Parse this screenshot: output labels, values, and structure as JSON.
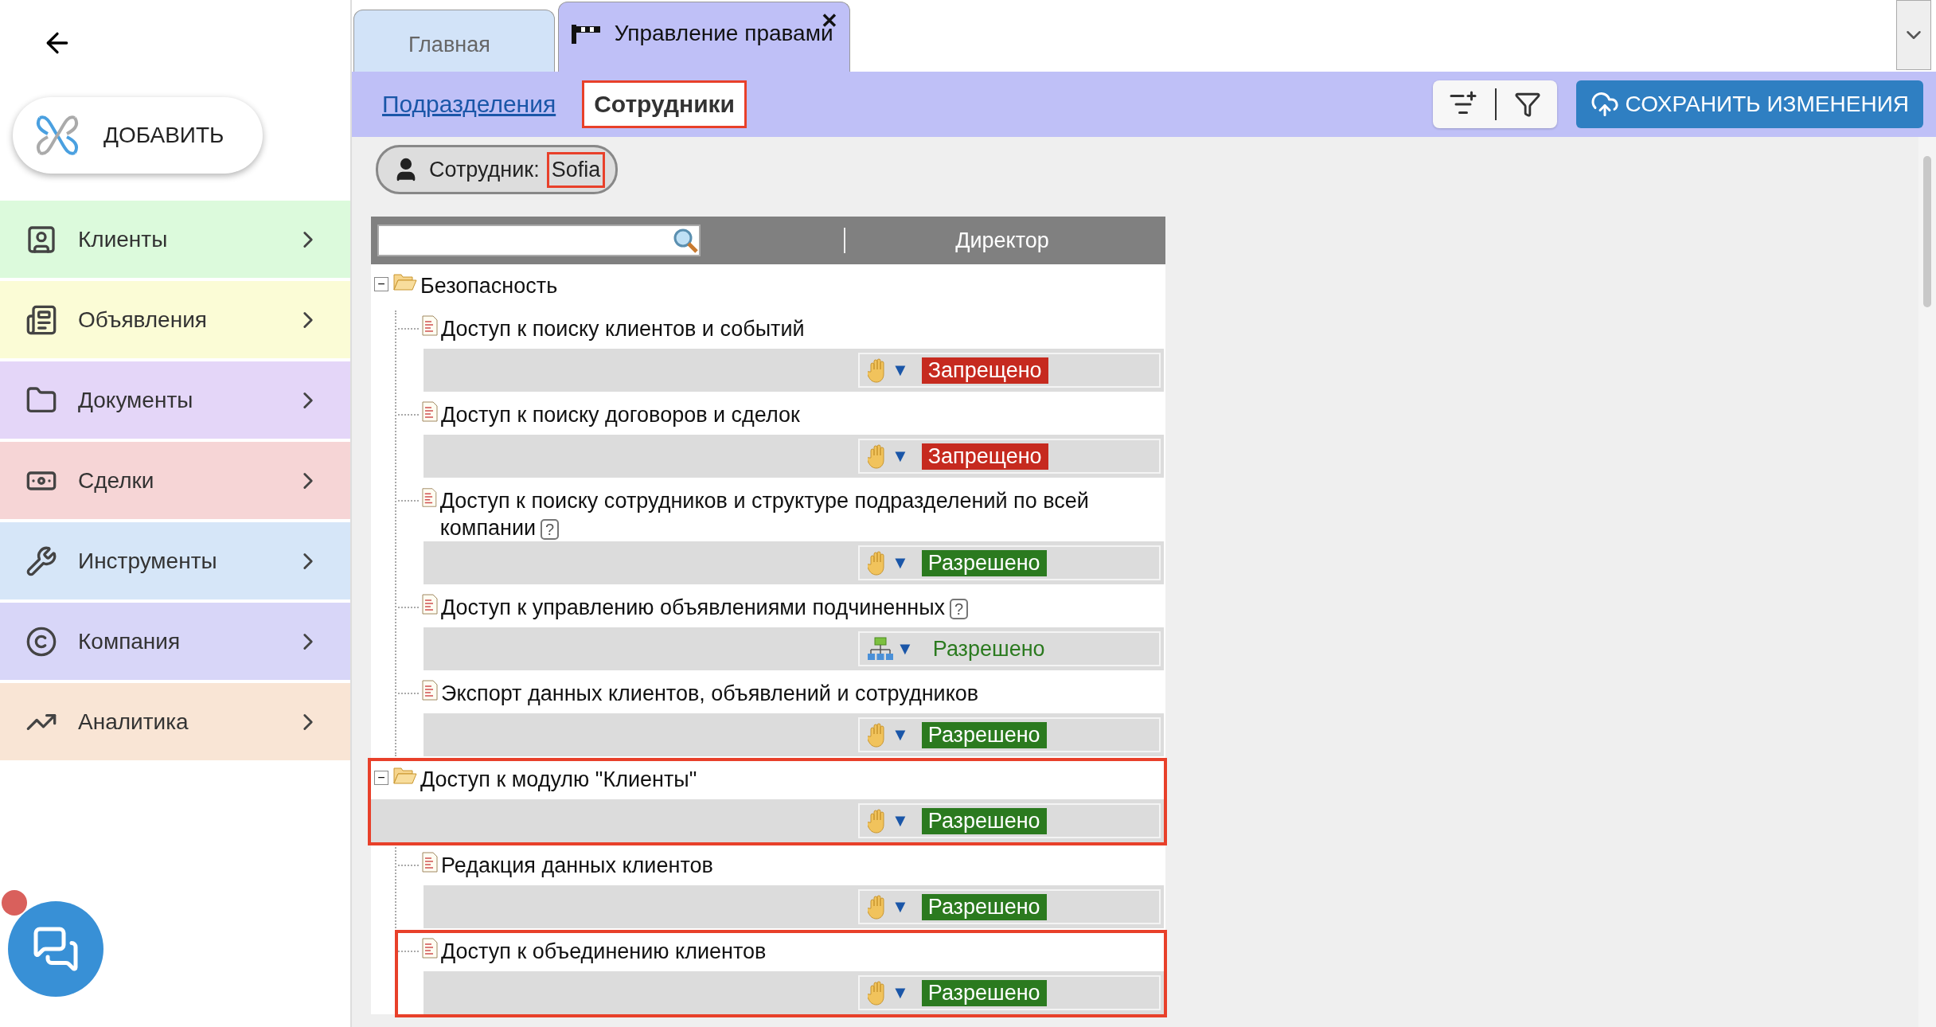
{
  "sidebar": {
    "add_button": "ДОБАВИТЬ",
    "items": [
      {
        "label": "Клиенты",
        "color": "#dcfadc"
      },
      {
        "label": "Объявления",
        "color": "#fbfcd6"
      },
      {
        "label": "Документы",
        "color": "#e4d6f8"
      },
      {
        "label": "Сделки",
        "color": "#f6d5d6"
      },
      {
        "label": "Инструменты",
        "color": "#d6e6f8"
      },
      {
        "label": "Компания",
        "color": "#d8d6f8"
      },
      {
        "label": "Аналитика",
        "color": "#f9e5d5"
      }
    ]
  },
  "tabs": [
    {
      "label": "Главная",
      "selected": false
    },
    {
      "label": "Управление правами",
      "selected": true,
      "close": "✕"
    }
  ],
  "subtabs": [
    {
      "label": "Подразделения",
      "selected": false,
      "highlighted": false
    },
    {
      "label": "Сотрудники",
      "selected": true,
      "highlighted": true
    }
  ],
  "save_button": "СОХРАНИТЬ ИЗМЕНЕНИЯ",
  "employee": {
    "label": "Сотрудник:",
    "value": "Sofia",
    "highlighted": true
  },
  "tree": {
    "column": "Директор",
    "nodes": [
      {
        "kind": "folder",
        "toggle": "−",
        "label": "Безопасность",
        "highlighted": false,
        "children": [
          {
            "kind": "doc",
            "label": "Доступ к поиску клиентов и событий",
            "highlighted": false,
            "permission": {
              "kind": "hand",
              "caret": "▼",
              "allowed": false,
              "inherited": false,
              "text": "Запрещено"
            }
          },
          {
            "kind": "doc",
            "label": "Доступ к поиску договоров и сделок",
            "highlighted": false,
            "permission": {
              "kind": "hand",
              "caret": "▼",
              "allowed": false,
              "inherited": false,
              "text": "Запрещено"
            }
          },
          {
            "kind": "doc",
            "label": "Доступ к поиску сотрудников и структуре подразделений по всей компании",
            "help_mark": "?",
            "highlighted": false,
            "permission": {
              "kind": "hand",
              "caret": "▼",
              "allowed": true,
              "inherited": false,
              "text": "Разрешено"
            }
          },
          {
            "kind": "doc",
            "label": "Доступ к управлению объявлениями подчиненных",
            "help_mark": "?",
            "highlighted": false,
            "permission": {
              "kind": "hierarchy",
              "caret": "▼",
              "allowed": true,
              "inherited": true,
              "text": "Разрешено"
            }
          },
          {
            "kind": "doc",
            "label": "Экспорт данных клиентов, объявлений и сотрудников",
            "highlighted": false,
            "permission": {
              "kind": "hand",
              "caret": "▼",
              "allowed": true,
              "inherited": false,
              "text": "Разрешено"
            }
          }
        ]
      },
      {
        "kind": "folder",
        "toggle": "−",
        "label": "Доступ к модулю \"Клиенты\"",
        "highlighted": true,
        "permission": {
          "kind": "hand",
          "caret": "▼",
          "allowed": true,
          "inherited": false,
          "text": "Разрешено"
        },
        "children": [
          {
            "kind": "doc",
            "label": "Редакция данных клиентов",
            "highlighted": false,
            "permission": {
              "kind": "hand",
              "caret": "▼",
              "allowed": true,
              "inherited": false,
              "text": "Разрешено"
            }
          },
          {
            "kind": "doc",
            "label": "Доступ к объединению клиентов",
            "highlighted": true,
            "permission": {
              "kind": "hand",
              "caret": "▼",
              "allowed": true,
              "inherited": false,
              "text": "Разрешено"
            }
          }
        ]
      }
    ]
  }
}
